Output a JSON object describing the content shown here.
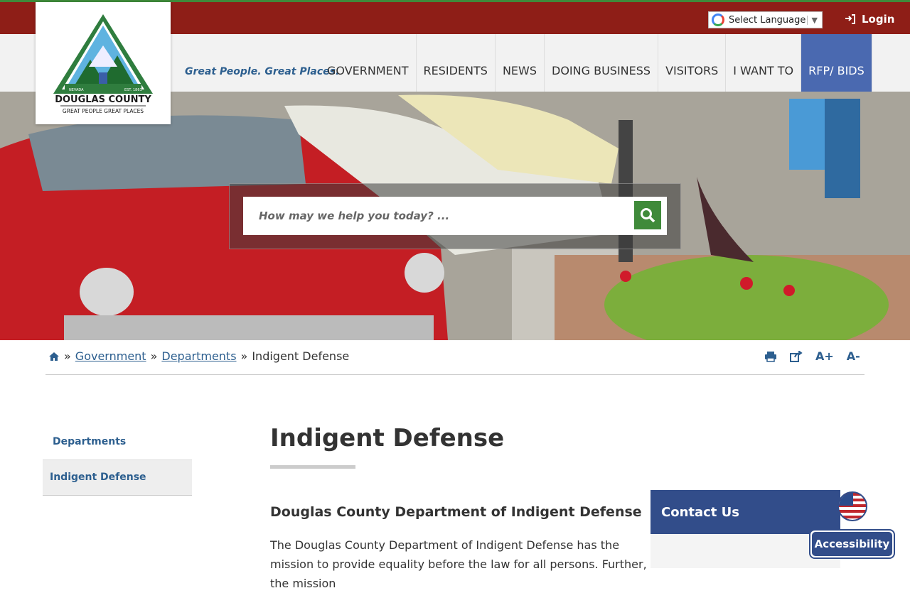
{
  "header": {
    "language_label": "Select Language",
    "login_label": "Login",
    "tagline": "Great People. Great Places.",
    "logo": {
      "county_name": "DOUGLAS COUNTY",
      "motto": "GREAT PEOPLE GREAT PLACES",
      "state": "NEVADA",
      "est": "EST. 1861"
    }
  },
  "nav": {
    "items": [
      "GOVERNMENT",
      "RESIDENTS",
      "NEWS",
      "DOING BUSINESS",
      "VISITORS",
      "I WANT TO",
      "RFP/ BIDS"
    ]
  },
  "search": {
    "placeholder": "How may we help you today? ..."
  },
  "breadcrumb": {
    "sep": "»",
    "items": [
      "Government",
      "Departments",
      "Indigent Defense"
    ]
  },
  "tools": {
    "font_increase": "A+",
    "font_decrease": "A-"
  },
  "sidebar": {
    "items": [
      {
        "label": "Departments"
      },
      {
        "label": "Indigent Defense"
      }
    ]
  },
  "main": {
    "title": "Indigent Defense",
    "subhead": "Douglas County Department of Indigent Defense",
    "paragraph": "The Douglas County Department of Indigent Defense has the mission to provide equality before the law for all persons. Further, the mission"
  },
  "contact": {
    "title": "Contact Us"
  },
  "accessibility": {
    "label": "Accessibility"
  },
  "colors": {
    "topbar": "#8e1e17",
    "accent_blue": "#4a69b0",
    "link": "#2d5f8f",
    "search_green": "#3f8a3a"
  }
}
